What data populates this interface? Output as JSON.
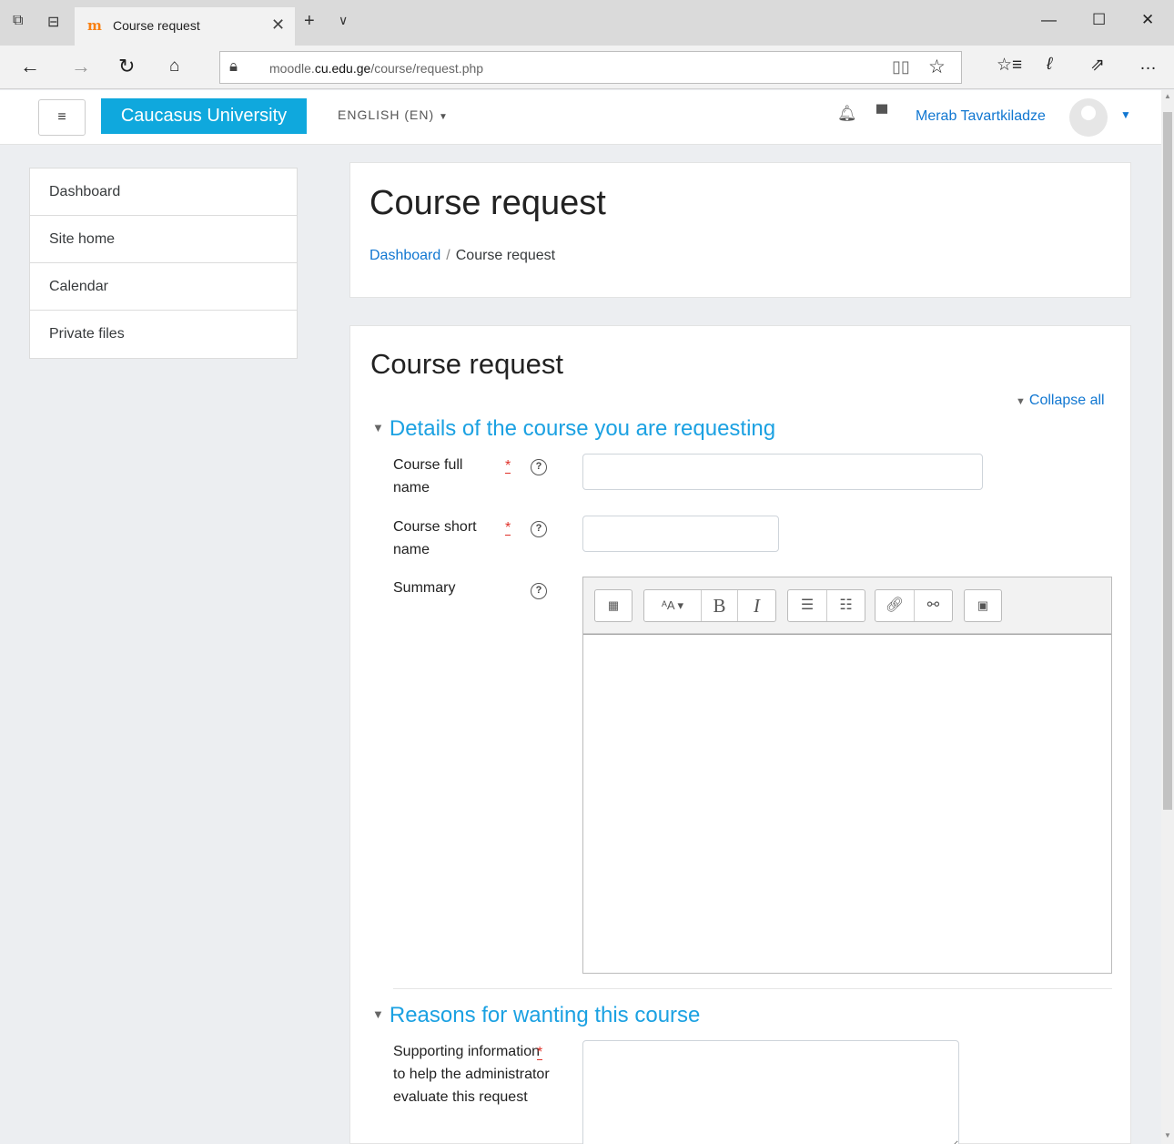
{
  "browser": {
    "tab_title": "Course request",
    "tab_logo": "m",
    "url_prefix": "moodle.",
    "url_domain": "cu.edu.ge",
    "url_path": "/course/request.php",
    "icons": [
      "tab-preview-icon",
      "set-aside-tabs-icon",
      "back-icon",
      "forward-icon",
      "refresh-icon",
      "home-icon",
      "lock-icon",
      "reading-view-icon",
      "favorite-star-icon",
      "favorites-hub-icon",
      "web-note-icon",
      "share-icon",
      "more-icon"
    ]
  },
  "header": {
    "menu_glyph": "≡",
    "brand": "Caucasus University",
    "language": "ENGLISH (EN)",
    "user_name": "Merab Tavartkiladze"
  },
  "sidebar": {
    "items": [
      {
        "label": "Dashboard"
      },
      {
        "label": "Site home"
      },
      {
        "label": "Calendar"
      },
      {
        "label": "Private files"
      }
    ]
  },
  "page_header": {
    "title": "Course request",
    "breadcrumb": {
      "link": "Dashboard",
      "separator": "/",
      "current": "Course request"
    }
  },
  "form": {
    "heading": "Course request",
    "collapse_all": "Collapse all",
    "section1": {
      "title": "Details of the course you are requesting",
      "full_name_label": "Course full name",
      "short_name_label": "Course short name",
      "summary_label": "Summary",
      "full_name_value": "",
      "short_name_value": ""
    },
    "section2": {
      "title": "Reasons for wanting this course",
      "reason_label": "Supporting information to help the administrator evaluate this request"
    },
    "required_marker": "*",
    "help_marker": "?"
  },
  "colors": {
    "brand": "#0fa8dd",
    "link": "#1177d1",
    "legend": "#1ba1e2",
    "required": "#e0322a"
  }
}
